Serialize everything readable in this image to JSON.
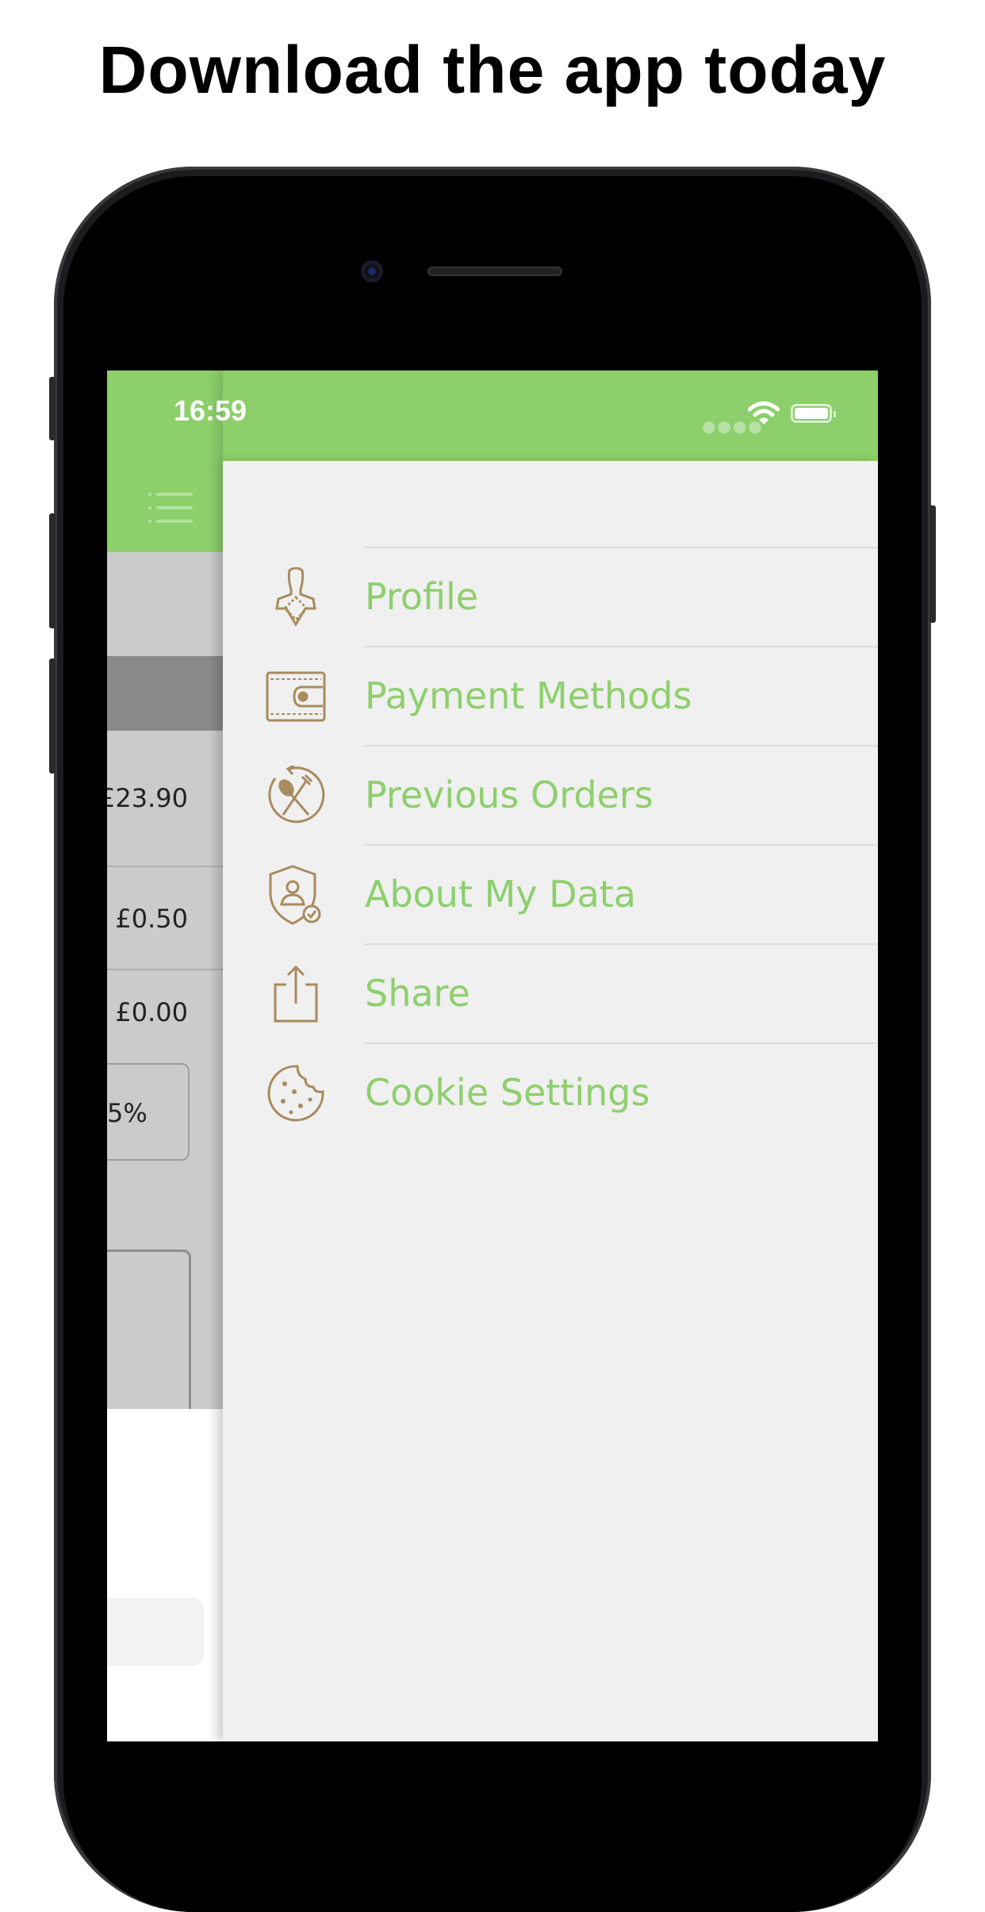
{
  "headline": "Download the app today",
  "status_bar": {
    "time": "16:59"
  },
  "background_screen": {
    "prices": [
      "£23.90",
      "£0.50",
      "£0.00"
    ],
    "percentage": "5%"
  },
  "menu": {
    "items": [
      {
        "label": "Profile",
        "icon": "profile-icon"
      },
      {
        "label": "Payment Methods",
        "icon": "wallet-icon"
      },
      {
        "label": "Previous Orders",
        "icon": "orders-icon"
      },
      {
        "label": "About My Data",
        "icon": "data-shield-icon"
      },
      {
        "label": "Share",
        "icon": "share-icon"
      },
      {
        "label": "Cookie Settings",
        "icon": "cookie-icon"
      }
    ]
  },
  "colors": {
    "brand_green": "#8ccf6b",
    "menu_text": "#8dcf6c",
    "icon_brown": "#a88b5e",
    "drawer_bg": "#f0f0f0"
  }
}
